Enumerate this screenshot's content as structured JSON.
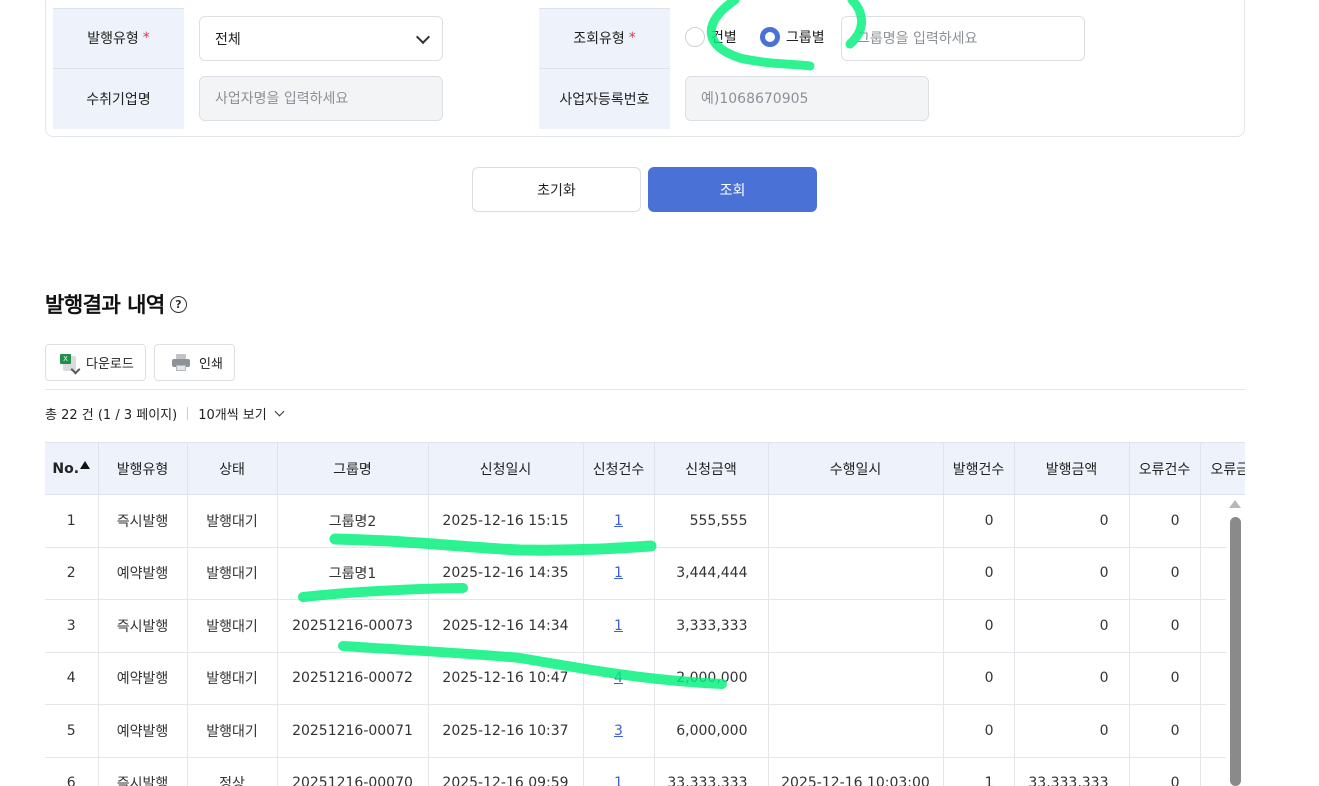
{
  "form": {
    "issue_type_label": "발행유형",
    "issue_type_value": "전체",
    "lookup_type_label": "조회유형",
    "radio_individual": "건별",
    "radio_group": "그룹별",
    "group_name_placeholder": "그룹명을 입력하세요",
    "recipient_label": "수취기업명",
    "recipient_placeholder": "사업자명을 입력하세요",
    "bizno_label": "사업자등록번호",
    "bizno_placeholder": "예)1068670905",
    "required_mark": "*"
  },
  "buttons": {
    "reset": "초기화",
    "search": "조회"
  },
  "section": {
    "title": "발행결과 내역",
    "help_glyph": "?"
  },
  "toolbar": {
    "download": "다운로드",
    "print": "인쇄",
    "excel_glyph": "X"
  },
  "summary": {
    "total": "총 22 건 (1 / 3 페이지)",
    "per_page": "10개씩 보기"
  },
  "table": {
    "headers": [
      "No.",
      "발행유형",
      "상태",
      "그룹명",
      "신청일시",
      "신청건수",
      "신청금액",
      "수행일시",
      "발행건수",
      "발행금액",
      "오류건수",
      "오류금액"
    ],
    "rows": [
      [
        "1",
        "즉시발행",
        "발행대기",
        "그룹명2",
        "2025-12-16 15:15",
        "1",
        "555,555",
        "",
        "0",
        "0",
        "0",
        ""
      ],
      [
        "2",
        "예약발행",
        "발행대기",
        "그룹명1",
        "2025-12-16 14:35",
        "1",
        "3,444,444",
        "",
        "0",
        "0",
        "0",
        ""
      ],
      [
        "3",
        "즉시발행",
        "발행대기",
        "20251216-00073",
        "2025-12-16 14:34",
        "1",
        "3,333,333",
        "",
        "0",
        "0",
        "0",
        ""
      ],
      [
        "4",
        "예약발행",
        "발행대기",
        "20251216-00072",
        "2025-12-16 10:47",
        "4",
        "2,000,000",
        "",
        "0",
        "0",
        "0",
        ""
      ],
      [
        "5",
        "예약발행",
        "발행대기",
        "20251216-00071",
        "2025-12-16 10:37",
        "3",
        "6,000,000",
        "",
        "0",
        "0",
        "0",
        ""
      ],
      [
        "6",
        "즉시발행",
        "정상",
        "20251216-00070",
        "2025-12-16 09:59",
        "1",
        "33,333,333",
        "2025-12-16 10:03:00",
        "1",
        "33,333,333",
        "0",
        ""
      ]
    ]
  },
  "colors": {
    "accent": "#4a72d6",
    "label_bg": "#eef3fb",
    "required": "#e0344a",
    "link": "#3d5fd0",
    "highlight": "#00f07a"
  }
}
